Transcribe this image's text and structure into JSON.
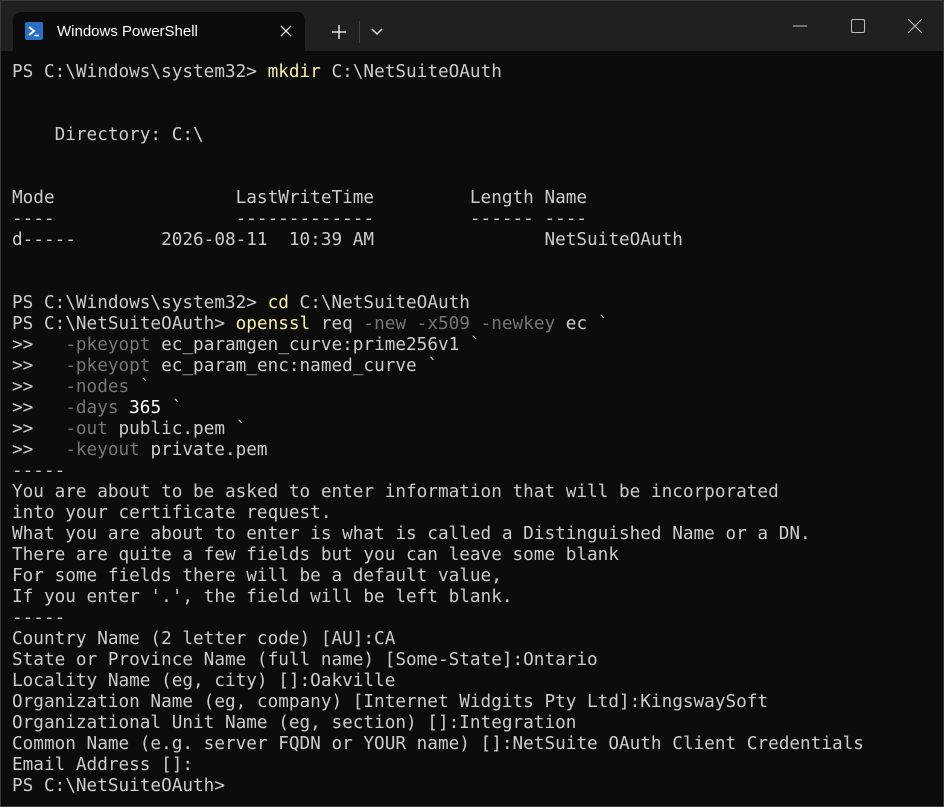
{
  "window": {
    "tab_title": "Windows PowerShell",
    "icons": {
      "tab": "powershell-icon",
      "close_tab": "close-icon",
      "new_tab": "plus-icon",
      "dropdown": "chevron-down-icon",
      "minimize": "minimize-icon",
      "maximize": "maximize-icon",
      "close_window": "close-icon"
    }
  },
  "terminal": {
    "prompt1": "PS C:\\Windows\\system32> ",
    "cmd_mkdir": "mkdir",
    "arg_mkdir": " C:\\NetSuiteOAuth",
    "directory_line": "    Directory: C:\\",
    "header_line": "Mode                 LastWriteTime         Length Name",
    "divider_line": "----                 -------------         ------ ----",
    "entry_line": "d-----        2026-08-11  10:39 AM                NetSuiteOAuth",
    "prompt2": "PS C:\\Windows\\system32> ",
    "cmd_cd": "cd",
    "arg_cd": " C:\\NetSuiteOAuth",
    "prompt3": "PS C:\\NetSuiteOAuth> ",
    "cmd_openssl": "openssl",
    "openssl_req": " req ",
    "p_new": "-new",
    "p_x509": " -x509",
    "p_newkey": " -newkey",
    "openssl_ec": " ec ",
    "tick": "`",
    "cont": ">>   ",
    "p_pkeyopt": "-pkeyopt",
    "v_curve": " ec_paramgen_curve:prime256v1 ",
    "v_enc": " ec_param_enc:named_curve ",
    "p_nodes": "-nodes",
    "p_days": "-days",
    "v_days": " 365 ",
    "p_out": "-out",
    "v_out": " public.pem ",
    "p_keyout": "-keyout",
    "v_keyout": " private.pem",
    "dashes": "-----",
    "info": [
      "You are about to be asked to enter information that will be incorporated",
      "into your certificate request.",
      "What you are about to enter is what is called a Distinguished Name or a DN.",
      "There are quite a few fields but you can leave some blank",
      "For some fields there will be a default value,",
      "If you enter '.', the field will be left blank."
    ],
    "fields": [
      "Country Name (2 letter code) [AU]:CA",
      "State or Province Name (full name) [Some-State]:Ontario",
      "Locality Name (eg, city) []:Oakville",
      "Organization Name (eg, company) [Internet Widgits Pty Ltd]:KingswaySoft",
      "Organizational Unit Name (eg, section) []:Integration",
      "Common Name (e.g. server FQDN or YOUR name) []:NetSuite OAuth Client Credentials",
      "Email Address []:"
    ],
    "final_prompt": "PS C:\\NetSuiteOAuth> "
  }
}
